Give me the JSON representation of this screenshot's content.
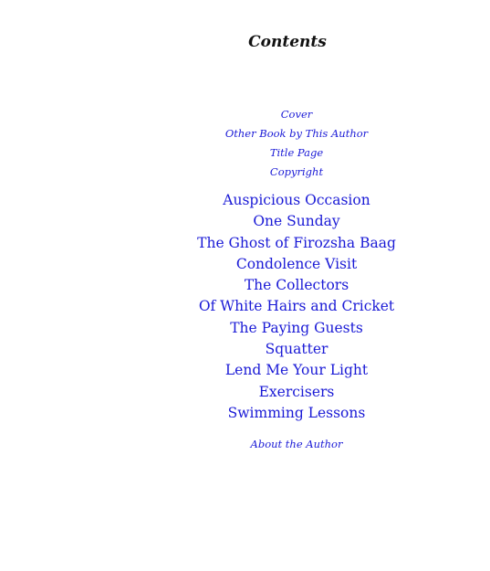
{
  "contents": {
    "title": "Contents",
    "front_matter": [
      {
        "label": "Cover"
      },
      {
        "label": "Other Book by This Author"
      },
      {
        "label": "Title Page"
      },
      {
        "label": "Copyright"
      }
    ],
    "chapters": [
      {
        "label": "Auspicious Occasion"
      },
      {
        "label": "One Sunday"
      },
      {
        "label": "The Ghost of Firozsha Baag"
      },
      {
        "label": "Condolence Visit"
      },
      {
        "label": "The Collectors"
      },
      {
        "label": "Of White Hairs and Cricket"
      },
      {
        "label": "The Paying Guests"
      },
      {
        "label": "Squatter"
      },
      {
        "label": "Lend Me Your Light"
      },
      {
        "label": "Exercisers"
      },
      {
        "label": "Swimming Lessons"
      }
    ],
    "back_matter": [
      {
        "label": "About the Author"
      }
    ],
    "link_color": "#1a1ad6",
    "title_color": "#111111"
  }
}
